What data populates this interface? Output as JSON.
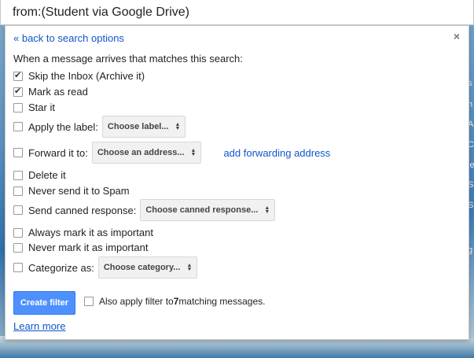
{
  "search": {
    "query": "from:(Student via Google Drive)"
  },
  "panel": {
    "back_link": "« back to search options",
    "close": "×",
    "heading": "When a message arrives that matches this search:",
    "options": {
      "skip_inbox": {
        "label": "Skip the Inbox (Archive it)",
        "checked": true
      },
      "mark_read": {
        "label": "Mark as read",
        "checked": true
      },
      "star": {
        "label": "Star it",
        "checked": false
      },
      "apply_label": {
        "label": "Apply the label:",
        "checked": false,
        "select": "Choose label..."
      },
      "forward": {
        "label": "Forward it to:",
        "checked": false,
        "select": "Choose an address...",
        "link": "add forwarding address"
      },
      "delete": {
        "label": "Delete it",
        "checked": false
      },
      "never_spam": {
        "label": "Never send it to Spam",
        "checked": false
      },
      "canned": {
        "label": "Send canned response:",
        "checked": false,
        "select": "Choose canned response..."
      },
      "always_important": {
        "label": "Always mark it as important",
        "checked": false
      },
      "never_important": {
        "label": "Never mark it as important",
        "checked": false
      },
      "categorize": {
        "label": "Categorize as:",
        "checked": false,
        "select": "Choose category..."
      }
    },
    "create_button": "Create filter",
    "also_apply": {
      "prefix": "Also apply filter to ",
      "count": "7",
      "suffix": " matching messages."
    },
    "learn_more": "Learn more"
  },
  "right_peek": [
    "s",
    "n",
    "A",
    "C",
    "le",
    "S",
    "S",
    "g"
  ]
}
